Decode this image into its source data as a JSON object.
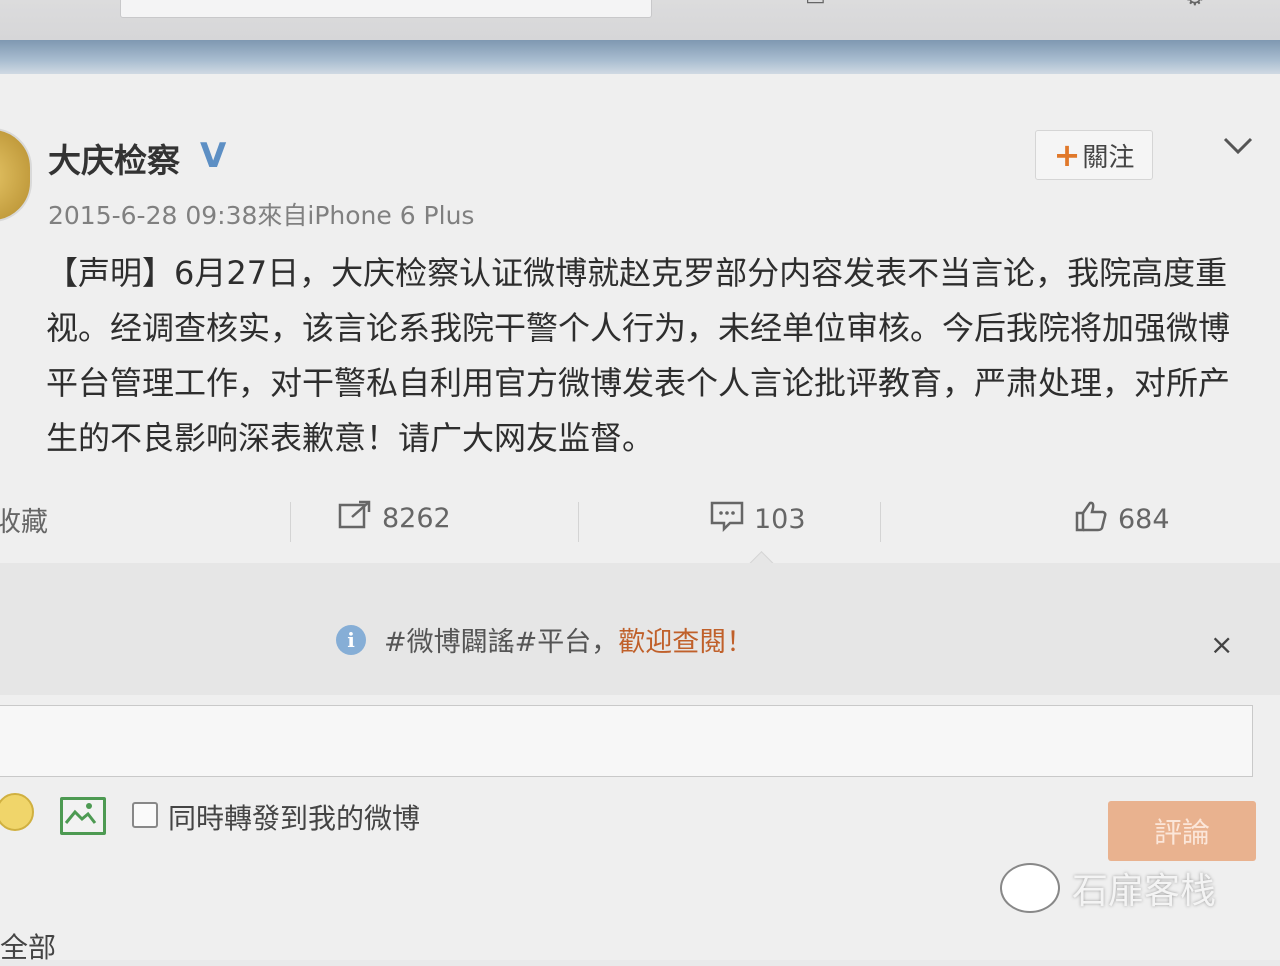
{
  "post": {
    "author": "大庆检察",
    "verified_badge": "V",
    "follow_label": "關注",
    "meta": "2015-6-28 09:38來自iPhone 6 Plus",
    "content": "【声明】6月27日，大庆检察认证微博就赵克罗部分内容发表不当言论，我院高度重视。经调查核实，该言论系我院干警个人行为，未经单位审核。今后我院将加强微博平台管理工作，对干警私自利用官方微博发表个人言论批评教育，严肃处理，对所产生的不良影响深表歉意！请广大网友监督。"
  },
  "actions": {
    "favorite_label": "收藏",
    "repost_count": "8262",
    "comment_count": "103",
    "like_count": "684"
  },
  "notice": {
    "text": "#微博闢謠#平台，",
    "link": "歡迎查閱！",
    "close": "×"
  },
  "composer": {
    "repost_checkbox_label": "同時轉發到我的微博",
    "submit_label": "評論"
  },
  "footer": {
    "filter_all": "全部"
  },
  "watermark": {
    "text": "石扉客栈"
  },
  "icons": {
    "repost": "share-arrow-icon",
    "comment": "comment-bubble-icon",
    "like": "thumbs-up-icon",
    "info": "info-icon",
    "emoji": "smiley-icon",
    "image": "image-icon"
  },
  "colors": {
    "accent_orange": "#e0782a",
    "link_orange": "#c0602a",
    "verified_blue": "#5d8fc4",
    "submit_disabled": "#e9b28f"
  }
}
